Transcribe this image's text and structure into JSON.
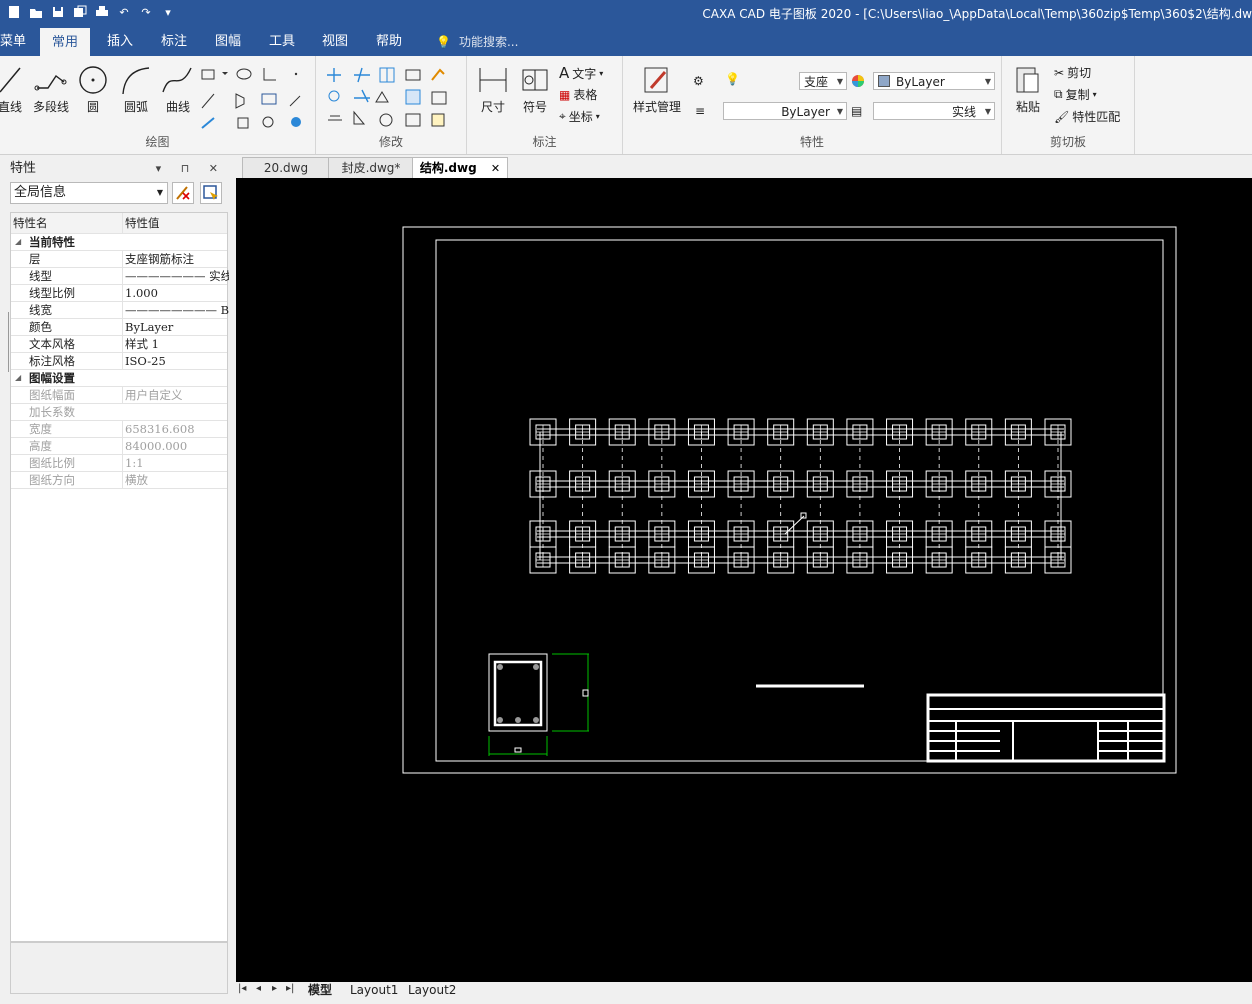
{
  "titlebar": {
    "title": "CAXA CAD 电子图板 2020 - [C:\\Users\\liao_\\AppData\\Local\\Temp\\360zip$Temp\\360$2\\结构.dw",
    "qat_icons": [
      "new-icon",
      "open-icon",
      "save-icon",
      "save-as-icon",
      "print-icon",
      "undo-icon",
      "redo-icon",
      "customize-icon"
    ]
  },
  "ribbon_tabs": {
    "menu": "菜单",
    "home": "常用",
    "insert": "插入",
    "annotate": "标注",
    "sheet": "图幅",
    "tools": "工具",
    "view": "视图",
    "help": "帮助",
    "search": "功能搜索..."
  },
  "draw_group": {
    "label": "绘图",
    "line": "直线",
    "polyline": "多段线",
    "circle": "圆",
    "arc": "圆弧",
    "curve": "曲线"
  },
  "modify_group": {
    "label": "修改"
  },
  "annot_group": {
    "label": "标注",
    "dimension": "尺寸",
    "symbol": "符号",
    "text": "文字",
    "table": "表格",
    "coordinate": "坐标"
  },
  "props_group": {
    "label": "特性",
    "style_mgr": "样式管理",
    "layer_value": "支座",
    "color_value": "ByLayer",
    "linetype_value": "ByLayer",
    "lineweight_value": "实线"
  },
  "clipboard_group": {
    "label": "剪切板",
    "paste": "粘贴",
    "cut": "剪切",
    "copy": "复制",
    "match": "特性匹配"
  },
  "panel": {
    "title": "特性",
    "controls": "▾ ⊓ ✕",
    "scope": "全局信息",
    "col_name": "特性名",
    "col_value": "特性值",
    "cat_current": "当前特性",
    "cat_sheet": "图幅设置",
    "rows_current": [
      {
        "k": "层",
        "v": "支座钢筋标注"
      },
      {
        "k": "线型",
        "v": "——————— 实线"
      },
      {
        "k": "线型比例",
        "v": "1.000"
      },
      {
        "k": "线宽",
        "v": "———————— ByLayer"
      },
      {
        "k": "颜色",
        "v": "ByLayer"
      },
      {
        "k": "文本风格",
        "v": "样式 1"
      },
      {
        "k": "标注风格",
        "v": "ISO-25"
      }
    ],
    "rows_sheet": [
      {
        "k": "图纸幅面",
        "v": "用户自定义"
      },
      {
        "k": "加长系数",
        "v": ""
      },
      {
        "k": "宽度",
        "v": "658316.608"
      },
      {
        "k": "高度",
        "v": "84000.000"
      },
      {
        "k": "图纸比例",
        "v": "1:1"
      },
      {
        "k": "图纸方向",
        "v": "横放"
      }
    ]
  },
  "doc_tabs": {
    "tab1": "20.dwg",
    "tab2": "封皮.dwg*",
    "tab3": "结构.dwg",
    "close": "✕"
  },
  "layout_tabs": {
    "nav": [
      "|◂",
      "◂",
      "▸",
      "▸|"
    ],
    "model": "模型",
    "layout1": "Layout1",
    "layout2": "Layout2"
  },
  "drawing": {
    "grid_columns": 14,
    "grid_rows": 4,
    "colors": {
      "canvas": "#000000",
      "lines": "#ffffff",
      "dimension": "#00c000",
      "accent": "#2b579a"
    }
  }
}
